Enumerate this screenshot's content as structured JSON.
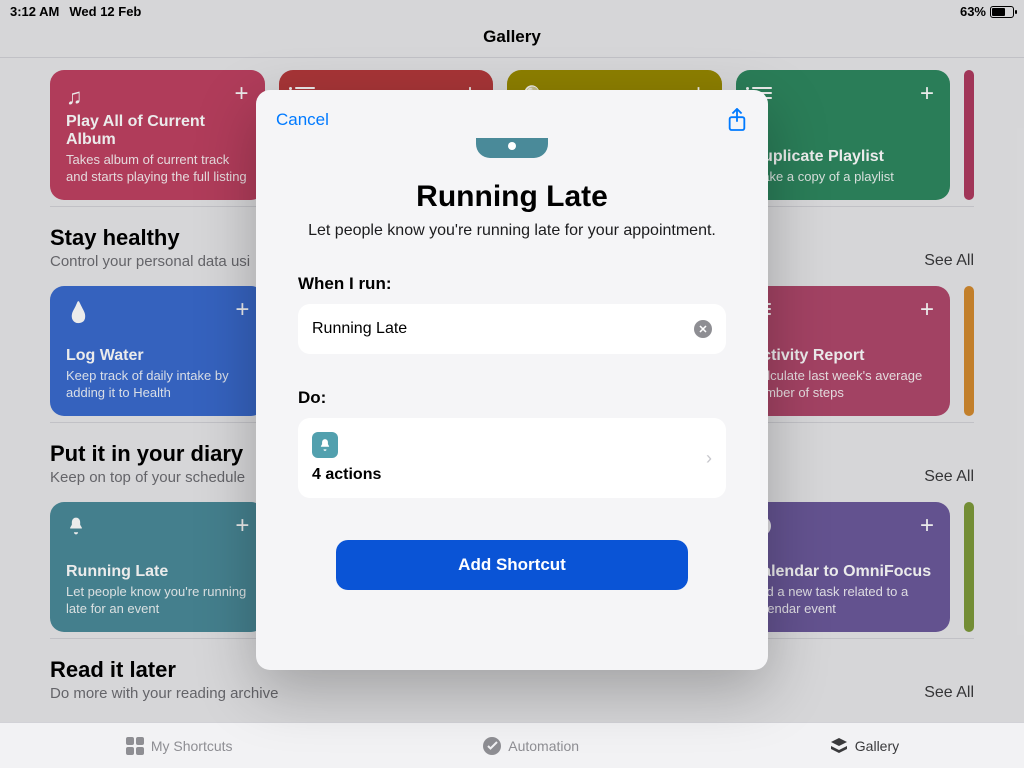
{
  "status": {
    "time": "3:12 AM",
    "date": "Wed 12 Feb",
    "battery": "63%"
  },
  "page": {
    "title": "Gallery"
  },
  "row1": {
    "card1": {
      "title": "Play All of Current Album",
      "desc": "Takes album of current track and starts playing the full listing"
    },
    "card4": {
      "title": "Duplicate Playlist",
      "desc": "Make a copy of a playlist"
    }
  },
  "section2": {
    "title": "Stay healthy",
    "sub": "Control your personal data usi",
    "see_all": "See All",
    "cardA": {
      "title": "Log Water",
      "desc": "Keep track of daily intake by adding it to Health"
    },
    "cardB": {
      "title": "Activity Report",
      "desc": "Calculate last week's average number of steps"
    }
  },
  "section3": {
    "title": "Put it in your diary",
    "sub": "Keep on top of your schedule",
    "see_all": "See All",
    "cardA": {
      "title": "Running Late",
      "desc": "Let people know you're running late for an event"
    },
    "cardB": {
      "title": "Calendar to OmniFocus",
      "desc": "Add a new task related to a calendar event"
    }
  },
  "section4": {
    "title": "Read it later",
    "sub": "Do more with your reading archive",
    "see_all": "See All"
  },
  "tabs": {
    "a": "My Shortcuts",
    "b": "Automation",
    "c": "Gallery"
  },
  "modal": {
    "cancel": "Cancel",
    "title": "Running Late",
    "subtitle": "Let people know you're running late for your appointment.",
    "when_label": "When I run:",
    "name_value": "Running Late",
    "do_label": "Do:",
    "actions": "4 actions",
    "add_button": "Add Shortcut"
  }
}
